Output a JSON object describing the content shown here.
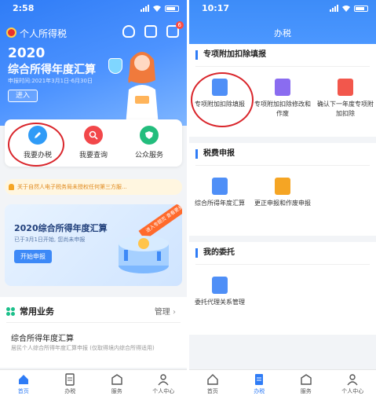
{
  "left": {
    "status": {
      "time": "2:58"
    },
    "header": {
      "app_title": "个人所得税",
      "message_badge": "6"
    },
    "hero": {
      "year": "2020",
      "title": "综合所得年度汇算",
      "period": "申报时间:2021年3月1日-6月30日",
      "enter_label": "进入"
    },
    "quick_actions": [
      {
        "label": "我要办税",
        "icon": "pencil-icon",
        "color": "#2f9bf7"
      },
      {
        "label": "我要查询",
        "icon": "search-icon",
        "color": "#f2474a"
      },
      {
        "label": "公众服务",
        "icon": "shield-icon",
        "color": "#23bd7d"
      }
    ],
    "notice": "关于自然人电子税务局未授权任何第三方服...",
    "banner": {
      "title": "2020综合所得年度汇算",
      "subtitle": "已于3月1日开始, 您尚未申报",
      "button": "开始申报",
      "ribbon": "进入专题页 查看更多"
    },
    "common": {
      "title": "常用业务",
      "manage": "管理",
      "item_title": "综合所得年度汇算",
      "item_desc": "居民个人综合所得年度汇算申报 (仅取得境内综合所得适用)"
    },
    "tabs": [
      "首页",
      "办税",
      "服务",
      "个人中心"
    ],
    "active_tab": "首页"
  },
  "right": {
    "status": {
      "time": "10:17"
    },
    "title": "办税",
    "sections": [
      {
        "title": "专项附加扣除填报",
        "items": [
          {
            "label": "专项附加扣除填报",
            "icon": "form-icon",
            "color": "#4f8ff7"
          },
          {
            "label": "专项附加扣除修改和作废",
            "icon": "edit-doc-icon",
            "color": "#8a6cf0"
          },
          {
            "label": "确认下一年度专项附加扣除",
            "icon": "check-doc-icon",
            "color": "#f2574c"
          }
        ]
      },
      {
        "title": "税费申报",
        "items": [
          {
            "label": "综合所得年度汇算",
            "icon": "annual-doc-icon",
            "color": "#4f8ff7"
          },
          {
            "label": "更正申报和作废申报",
            "icon": "correct-doc-icon",
            "color": "#f5a524"
          }
        ]
      },
      {
        "title": "我的委托",
        "items": [
          {
            "label": "委托代理关系管理",
            "icon": "delegate-doc-icon",
            "color": "#4f8ff7"
          }
        ]
      }
    ],
    "tabs": [
      "首页",
      "办税",
      "服务",
      "个人中心"
    ],
    "active_tab": "办税"
  }
}
